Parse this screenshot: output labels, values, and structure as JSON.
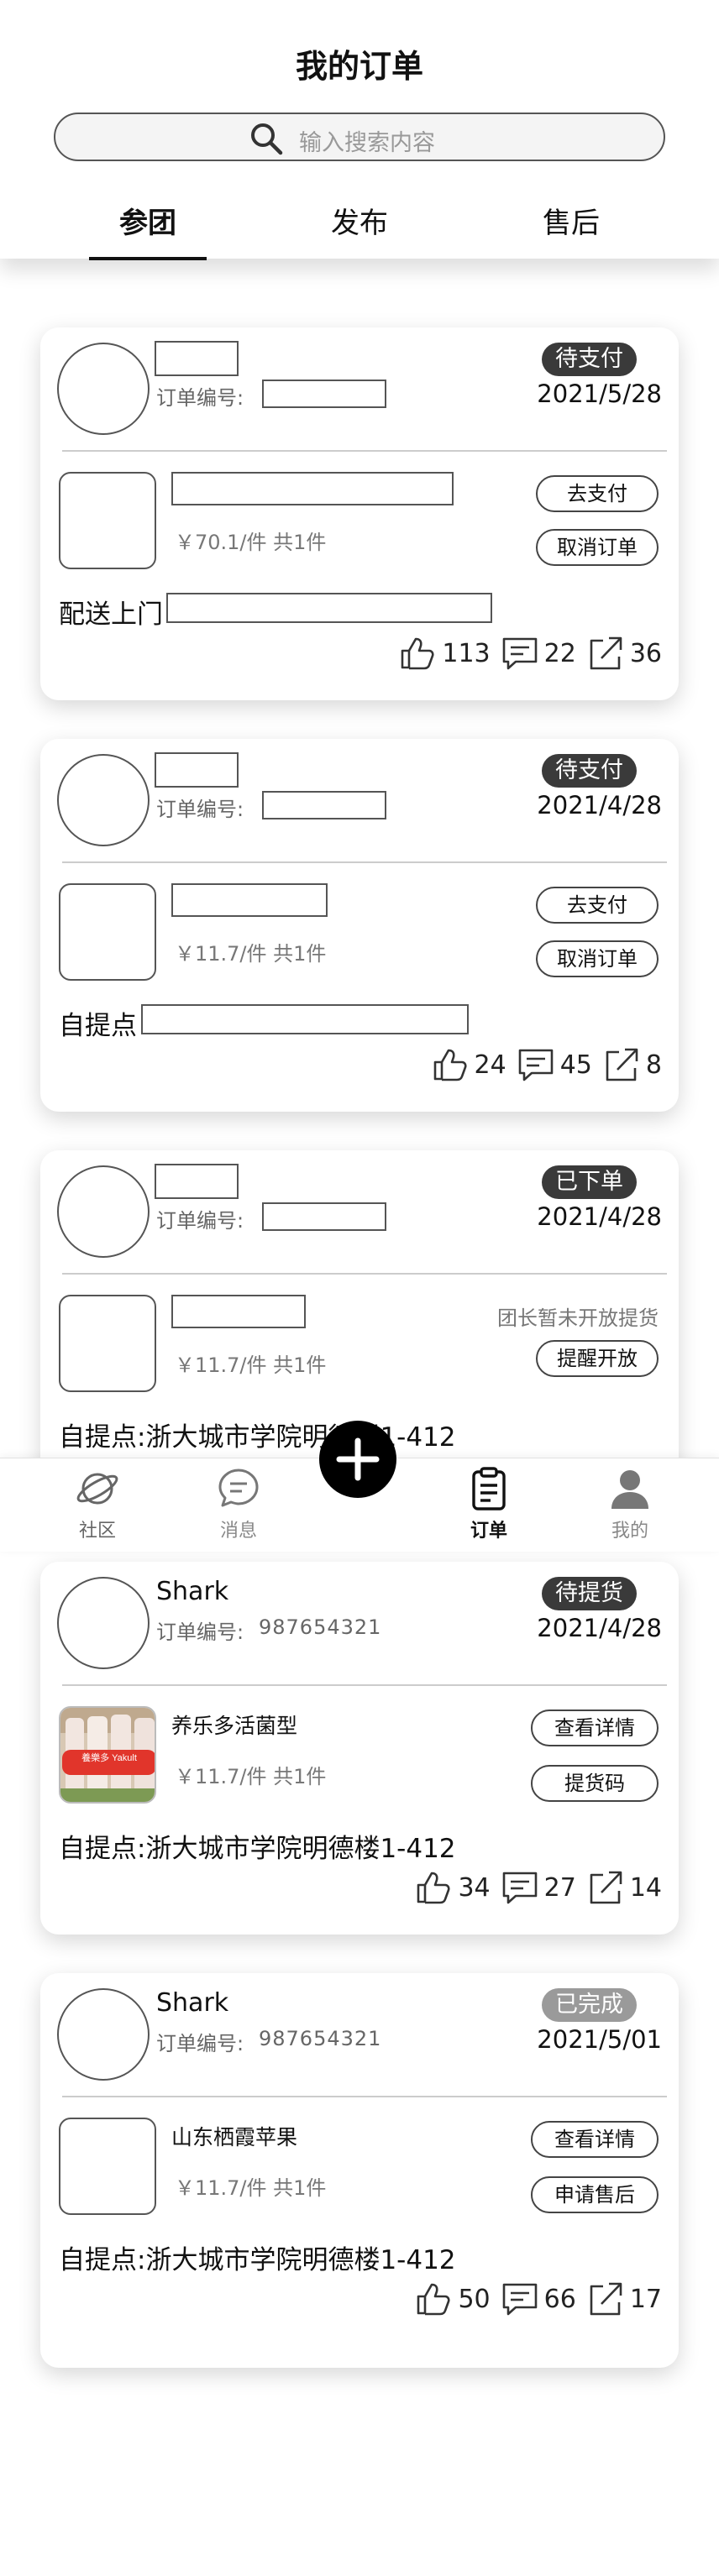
{
  "header": {
    "title": "我的订单",
    "search_placeholder": "输入搜索内容",
    "tabs": [
      "参团",
      "发布",
      "售后"
    ]
  },
  "orders": [
    {
      "order_label": "订单编号:",
      "status": "待支付",
      "date": "2021/5/28",
      "price": "￥70.1/件 共1件",
      "btn1": "去支付",
      "btn2": "取消订单",
      "delivery": "配送上门",
      "likes": "113",
      "comments": "22",
      "shares": "36"
    },
    {
      "order_label": "订单编号:",
      "status": "待支付",
      "date": "2021/4/28",
      "price": "￥11.7/件 共1件",
      "btn1": "去支付",
      "btn2": "取消订单",
      "delivery": "自提点",
      "likes": "24",
      "comments": "45",
      "shares": "8"
    },
    {
      "order_label": "订单编号:",
      "status": "已下单",
      "date": "2021/4/28",
      "price": "￥11.7/件 共1件",
      "note": "团长暂未开放提货",
      "btn2": "提醒开放",
      "delivery": "自提点:浙大城市学院明德楼1-412"
    },
    {
      "name": "Shark",
      "order_label": "订单编号:",
      "order_no": "987654321",
      "status": "待提货",
      "date": "2021/4/28",
      "product": "养乐多活菌型",
      "product_image_text": "養樂多 Yakult",
      "price": "￥11.7/件 共1件",
      "btn1": "查看详情",
      "btn2": "提货码",
      "delivery": "自提点:浙大城市学院明德楼1-412",
      "likes": "34",
      "comments": "27",
      "shares": "14"
    },
    {
      "name": "Shark",
      "order_label": "订单编号:",
      "order_no": "987654321",
      "status": "已完成",
      "date": "2021/5/01",
      "product": "山东栖霞苹果",
      "price": "￥11.7/件 共1件",
      "btn1": "查看详情",
      "btn2": "申请售后",
      "delivery": "自提点:浙大城市学院明德楼1-412",
      "likes": "50",
      "comments": "66",
      "shares": "17"
    }
  ],
  "tabbar": {
    "items": [
      "社区",
      "消息",
      "订单",
      "我的"
    ],
    "active": "订单"
  },
  "colors": {
    "badge_dark": "#3a3a3a",
    "badge_done": "#9a9a9a",
    "text": "#111111",
    "muted": "#777777"
  }
}
